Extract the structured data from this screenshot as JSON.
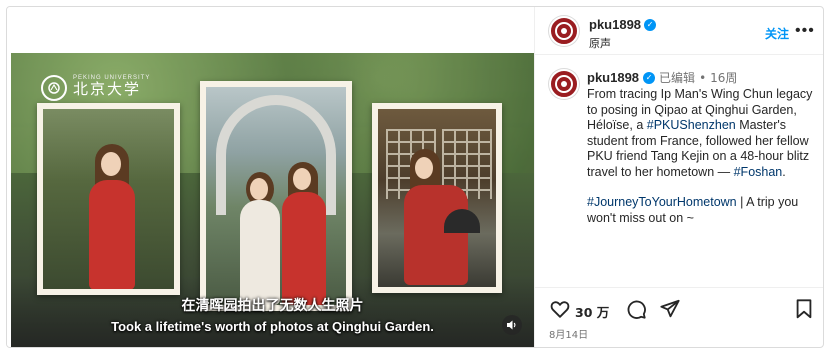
{
  "video": {
    "logo_text": "北京大学",
    "logo_sub": "PEKING UNIVERSITY",
    "caption_cn": "在清晖园拍出了无数人生照片",
    "caption_en": "Took a lifetime's worth of photos at Qinghui Garden.",
    "sound_icon": "volume-icon"
  },
  "header": {
    "username": "pku1898",
    "subtitle": "原声",
    "follow_label": "关注",
    "more_label": "•••"
  },
  "post": {
    "username": "pku1898",
    "edited": "已编辑",
    "separator": "•",
    "time_ago": "16周",
    "caption_1a": "From tracing Ip Man's Wing Chun legacy to posing in Qipao at Qinghui Garden, Héloïse, a ",
    "caption_1_tag": "#PKUShenzhen",
    "caption_1b": " Master's student from France, followed her fellow PKU friend Tang Kejin on a 48-hour blitz travel to her hometown — ",
    "caption_1_tag2": "#Foshan",
    "caption_1c": ".",
    "caption_2_tag": "#JourneyToYourHometown",
    "caption_2b": " | A trip you won't miss out on ~"
  },
  "actions": {
    "likes": "30 万",
    "date": "8月14日"
  },
  "colors": {
    "accent": "#0095f6",
    "hashtag": "#00376b",
    "brand": "#9a1d21"
  }
}
